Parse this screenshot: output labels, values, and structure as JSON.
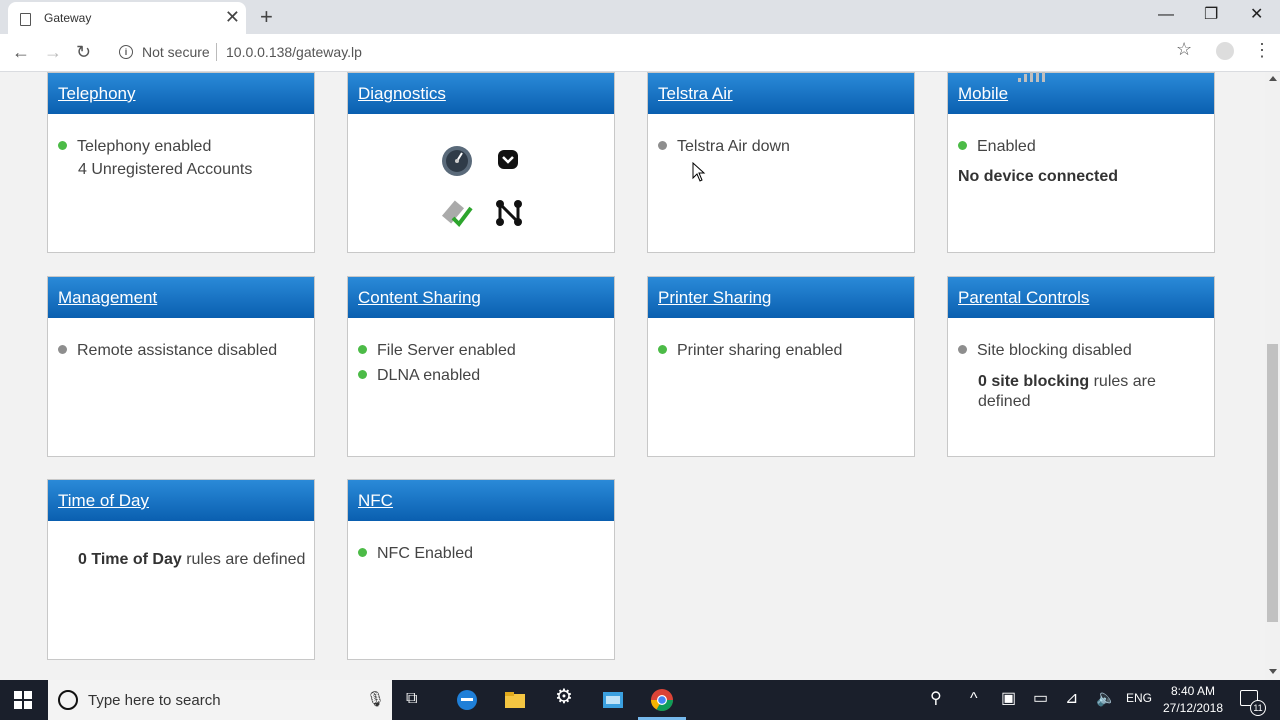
{
  "browser": {
    "tab_title": "Gateway",
    "tab_close": "✕",
    "new_tab": "+",
    "security_label": "Not secure",
    "url": "10.0.0.138/gateway.lp"
  },
  "cards": {
    "telephony": {
      "title": "Telephony",
      "line1": "Telephony enabled",
      "line2": "4 Unregistered Accounts"
    },
    "diagnostics": {
      "title": "Diagnostics"
    },
    "telstra_air": {
      "title": "Telstra Air",
      "line1": "Telstra Air down"
    },
    "mobile": {
      "title": "Mobile",
      "line1": "Enabled",
      "line2": "No device connected"
    },
    "management": {
      "title": "Management",
      "line1": "Remote assistance disabled"
    },
    "content_sharing": {
      "title": "Content Sharing",
      "line1": "File Server enabled",
      "line2": "DLNA enabled"
    },
    "printer_sharing": {
      "title": "Printer Sharing",
      "line1": "Printer sharing enabled"
    },
    "parental_controls": {
      "title": "Parental Controls",
      "line1": "Site blocking disabled",
      "count_bold": "0 site blocking",
      "count_rest1": " rules are",
      "count_rest2": "defined"
    },
    "time_of_day": {
      "title": "Time of Day",
      "count_bold": "0 Time of Day",
      "count_rest": " rules are defined"
    },
    "nfc": {
      "title": "NFC",
      "line1": "NFC Enabled"
    }
  },
  "taskbar": {
    "search_placeholder": "Type here to search",
    "lang": "ENG",
    "time": "8:40 AM",
    "date": "27/12/2018",
    "notifications": "11"
  },
  "colors": {
    "header_top": "#2a8ad8",
    "header_bottom": "#0a5fb0",
    "status_on": "#4cbb47",
    "status_off": "#8e8e8e"
  }
}
